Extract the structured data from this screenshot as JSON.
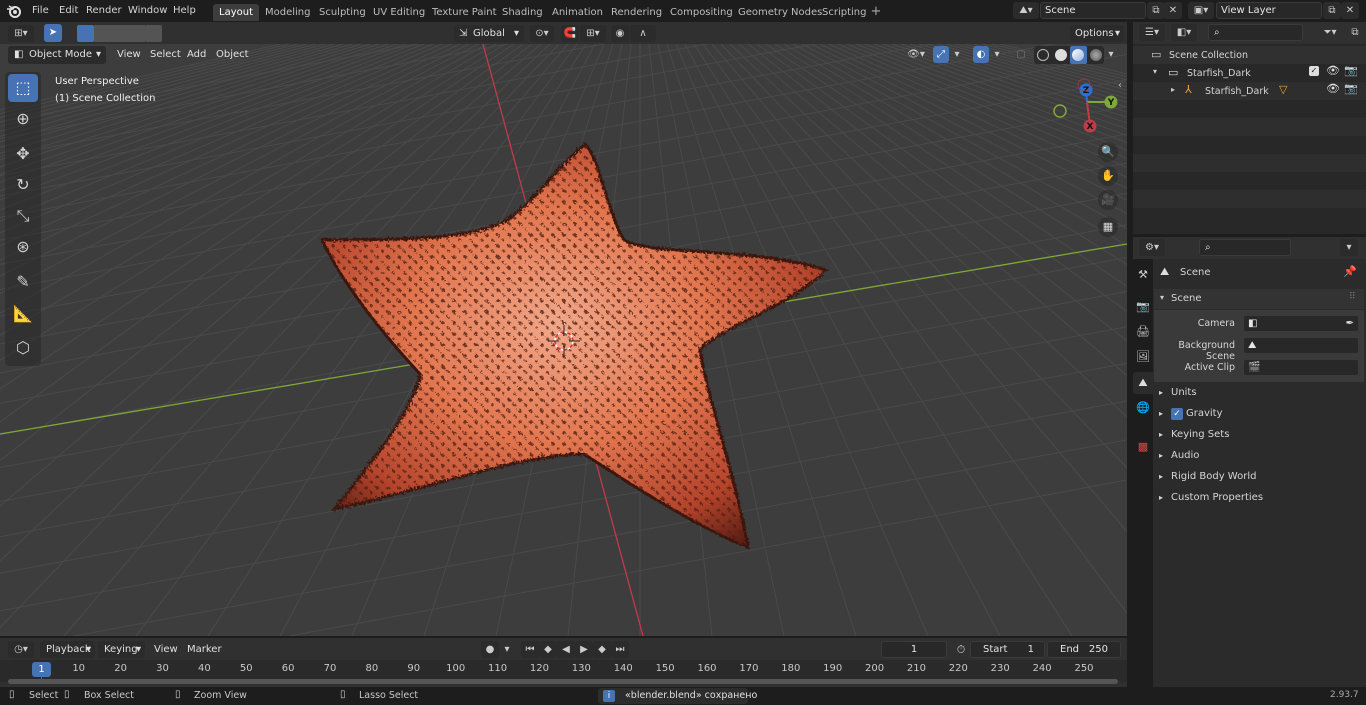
{
  "topbar": {
    "menus": [
      "File",
      "Edit",
      "Render",
      "Window",
      "Help"
    ],
    "workspaces": [
      "Layout",
      "Modeling",
      "Sculpting",
      "UV Editing",
      "Texture Paint",
      "Shading",
      "Animation",
      "Rendering",
      "Compositing",
      "Geometry Nodes",
      "Scripting"
    ],
    "active_workspace": "Layout",
    "scene_name": "Scene",
    "view_layer": "View Layer"
  },
  "viewport": {
    "mode": "Object Mode",
    "menus": [
      "View",
      "Select",
      "Add",
      "Object"
    ],
    "transform_orientation": "Global",
    "options_label": "Options",
    "perspective_label": "User Perspective",
    "collection_label": "(1) Scene Collection",
    "gizmo_axes": [
      "Z",
      "Y",
      "X"
    ]
  },
  "outliner": {
    "items": [
      {
        "label": "Scene Collection",
        "depth": 0
      },
      {
        "label": "Starfish_Dark",
        "depth": 1
      },
      {
        "label": "Starfish_Dark",
        "depth": 2
      }
    ]
  },
  "properties": {
    "context_title": "Scene",
    "panel_title": "Scene",
    "fields": [
      {
        "label": "Camera"
      },
      {
        "label": "Background Scene"
      },
      {
        "label": "Active Clip"
      }
    ],
    "subpanels": [
      "Units",
      "Gravity",
      "Keying Sets",
      "Audio",
      "Rigid Body World",
      "Custom Properties"
    ],
    "gravity_checked": true
  },
  "timeline": {
    "menus": [
      "Playback",
      "Keying",
      "View",
      "Marker"
    ],
    "current_frame": "1",
    "start_label": "Start",
    "start_value": "1",
    "end_label": "End",
    "end_value": "250",
    "ticks": [
      "1",
      "10",
      "20",
      "30",
      "40",
      "50",
      "60",
      "70",
      "80",
      "90",
      "100",
      "110",
      "120",
      "130",
      "140",
      "150",
      "160",
      "170",
      "180",
      "190",
      "200",
      "210",
      "220",
      "230",
      "240",
      "250"
    ]
  },
  "statusbar": {
    "select": "Select",
    "box_select": "Box Select",
    "zoom_view": "Zoom View",
    "lasso_select": "Lasso Select",
    "message": "«blender.blend» сохранено",
    "version": "2.93.7"
  },
  "colors": {
    "accent": "#4772b3",
    "viewport_bg": "#3d3d3d",
    "x_axis": "#c23a4a",
    "y_axis": "#7ea838",
    "starfish": "#d9684a"
  }
}
